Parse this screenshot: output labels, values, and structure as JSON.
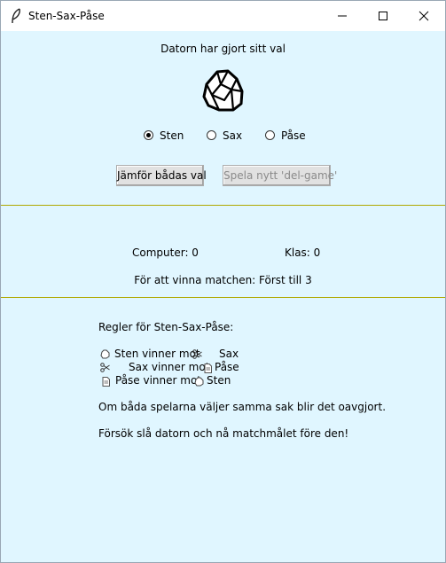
{
  "window": {
    "title": "Sten-Sax-Påse"
  },
  "status_text": "Datorn har gjort sitt val",
  "radios": [
    {
      "label": "Sten",
      "checked": true
    },
    {
      "label": "Sax",
      "checked": false
    },
    {
      "label": "Påse",
      "checked": false
    }
  ],
  "buttons": {
    "compare": "Jämför bådas val",
    "new_game": "Spela nytt 'del-game'"
  },
  "score": {
    "computer": "Computer: 0",
    "player": "Klas: 0"
  },
  "goal_text": "För att vinna matchen: Först till 3",
  "rules": {
    "heading": "Regler för Sten-Sax-Påse:",
    "line1": {
      "a": "Sten vinner mot",
      "b": "Sax"
    },
    "line2": {
      "a": "Sax vinner mot",
      "b": "Påse"
    },
    "line3": {
      "a": "Påse vinner mot",
      "b": "Sten"
    },
    "draw": "Om båda spelarna väljer samma sak blir det oavgjort.",
    "challenge": "Försök slå datorn och nå matchmålet före den!"
  },
  "icons": {
    "computer_choice": "rock-icon",
    "rock": "rock-icon",
    "scissors": "scissors-icon",
    "paper": "paper-icon"
  }
}
